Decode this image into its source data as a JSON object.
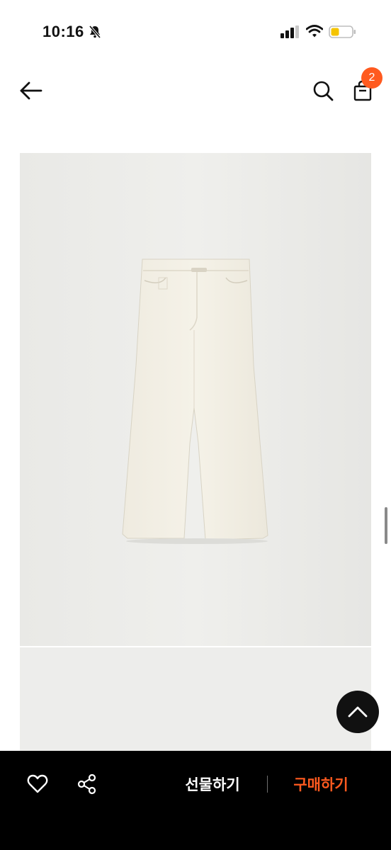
{
  "status_bar": {
    "time": "10:16",
    "battery_color": "#f5c400"
  },
  "header": {
    "back_icon": "arrow-left-icon",
    "search_icon": "search-icon",
    "bag_icon": "shopping-bag-icon",
    "cart_count": "2",
    "badge_color": "#ff5a1f"
  },
  "gallery": {
    "images": [
      "product-photo-pants",
      "product-photo-second"
    ]
  },
  "bottom_bar": {
    "like_icon": "heart-icon",
    "share_icon": "share-icon",
    "gift_label": "선물하기",
    "buy_label": "구매하기",
    "buy_color": "#ff5a1f"
  }
}
